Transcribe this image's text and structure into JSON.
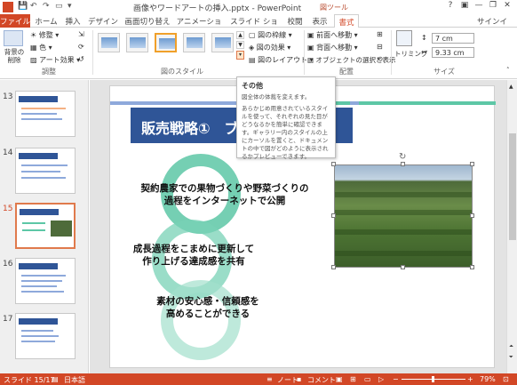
{
  "titlebar": {
    "title": "画像やワードアートの挿入.pptx - PowerPoint",
    "contextual_group": "図ツール",
    "help": "?",
    "minimize": "—",
    "restore": "❐",
    "close": "✕"
  },
  "tabs": {
    "file": "ファイル",
    "home": "ホーム",
    "insert": "挿入",
    "design": "デザイン",
    "transitions": "画面切り替え",
    "animations": "アニメーション",
    "slideshow": "スライド ショー",
    "review": "校閲",
    "view": "表示",
    "format": "書式",
    "signin": "サインイン"
  },
  "ribbon": {
    "remove_bg": "背景の\n削除",
    "corrections": "修整",
    "color": "色",
    "artistic": "アート効果",
    "group_adjust": "調整",
    "group_styles": "図のスタイル",
    "picture_border": "図の枠線",
    "picture_effects": "図の効果",
    "picture_layout": "図のレイアウト",
    "bring_forward": "前面へ移動",
    "send_backward": "背面へ移動",
    "selection_pane": "オブジェクトの選択と表示",
    "group_arrange": "配置",
    "crop": "トリミング",
    "height": "7 cm",
    "width": "9.33 cm",
    "group_size": "サイズ"
  },
  "tooltip": {
    "title": "その他",
    "subtitle": "図全体の体裁を変えます。",
    "body": "あらかじめ用意されているスタイルを使って、それぞれの見た目がどうなるかを簡単に確認できます。ギャラリー内のスタイルの上にカーソルを置くと、ドキュメントの中で図がどのように表示されるかプレビューできます。"
  },
  "slides": [
    {
      "num": "13"
    },
    {
      "num": "14"
    },
    {
      "num": "15"
    },
    {
      "num": "16"
    },
    {
      "num": "17"
    }
  ],
  "slide": {
    "heading": "販売戦略①　ブ",
    "cycle_items": [
      "契約農家での果物づくりや野菜づくりの\n過程をインターネットで公開",
      "成長過程をこまめに更新して\n作り上げる達成感を共有",
      "素材の安心感・信頼感を\n高めることができる"
    ]
  },
  "status": {
    "slide": "スライド 15/17",
    "language": "日本語",
    "notes": "ノート",
    "comments": "コメント",
    "zoom": "79%"
  },
  "colors": {
    "accent": "#d24726",
    "header_blue": "#2f5597",
    "ring_green": "#5dc7a6"
  }
}
